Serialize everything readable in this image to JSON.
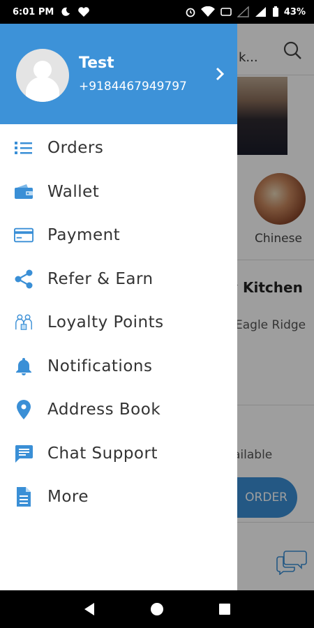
{
  "status_bar": {
    "time": "6:01 PM",
    "battery": "43%"
  },
  "background_app": {
    "location_text": "k...",
    "cuisine_label": "Chinese",
    "restaurant_name": "y Kitchen",
    "restaurant_location": "Eagle Ridge",
    "availability_text": "ailable",
    "order_button_label": "ORDER"
  },
  "drawer": {
    "user": {
      "name": "Test",
      "phone": "+9184467949797"
    },
    "menu_items": [
      {
        "label": "Orders",
        "icon": "list-icon"
      },
      {
        "label": "Wallet",
        "icon": "wallet-icon"
      },
      {
        "label": "Payment",
        "icon": "card-icon"
      },
      {
        "label": "Refer & Earn",
        "icon": "share-icon"
      },
      {
        "label": "Loyalty Points",
        "icon": "loyalty-icon"
      },
      {
        "label": "Notifications",
        "icon": "bell-icon"
      },
      {
        "label": "Address Book",
        "icon": "location-pin-icon"
      },
      {
        "label": "Chat Support",
        "icon": "chat-icon"
      },
      {
        "label": "More",
        "icon": "document-icon"
      }
    ]
  },
  "colors": {
    "accent": "#3d92d8",
    "icon": "#3a8fd6",
    "text": "#333333"
  }
}
